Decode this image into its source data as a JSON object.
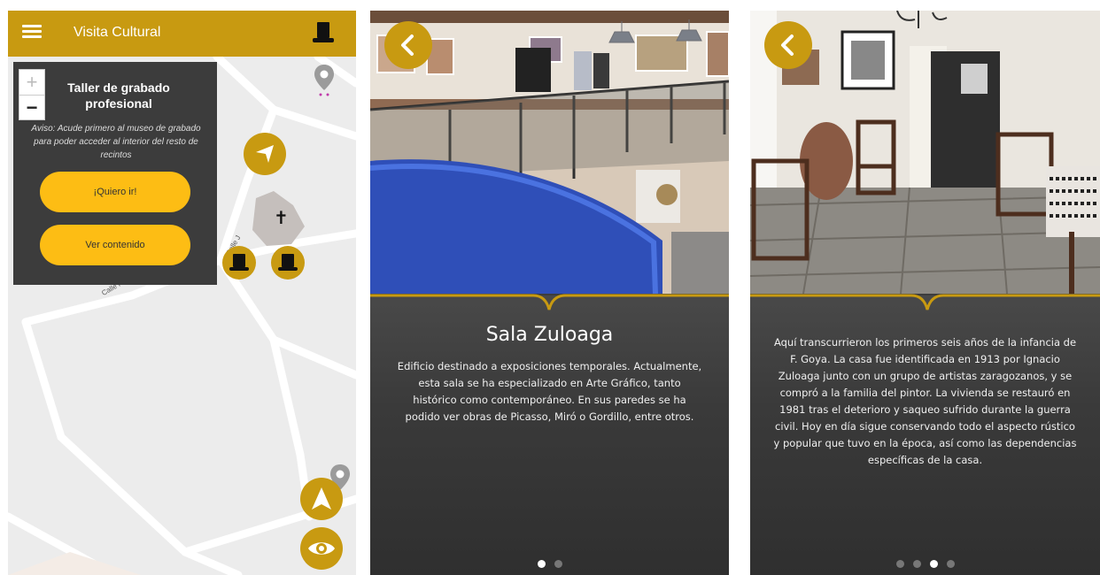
{
  "screen_map": {
    "app_title": "Visita Cultural",
    "menu_icon": "hamburger-menu-icon",
    "hat_icon": "top-hat-icon",
    "zoom_in_label": "+",
    "zoom_out_label": "−",
    "popup": {
      "title": "Taller de grabado profesional",
      "note": "Aviso: Acude primero al museo de grabado para poder acceder al interior del resto de recintos",
      "go_button": "¡Quiero ir!",
      "content_button": "Ver contenido"
    },
    "street_labels": [
      "Calle J",
      "Calle P"
    ],
    "brand_color": "#c89a11",
    "button_color": "#fdbd14"
  },
  "screen_room1": {
    "title": "Sala Zuloaga",
    "description": "Edificio destinado a exposiciones temporales. Actualmente, esta sala se ha especializado en Arte Gráfico, tanto histórico como contemporáneo. En sus paredes se ha podido ver obras de Picasso, Miró o Gordillo, entre otros.",
    "pagination": {
      "total": 2,
      "active": 0
    }
  },
  "screen_room2": {
    "description": "Aquí transcurrieron los primeros seis años de la infancia de F. Goya. La casa fue identificada en 1913 por Ignacio Zuloaga junto con un grupo de artistas zaragozanos, y se compró a la familia del pintor. La vivienda se restauró en 1981 tras el deterioro y saqueo sufrido durante la guerra civil. Hoy en día sigue conservando todo el aspecto rústico y popular que tuvo en la época, así como las dependencias específicas de la casa.",
    "pagination": {
      "total": 4,
      "active": 2
    }
  }
}
